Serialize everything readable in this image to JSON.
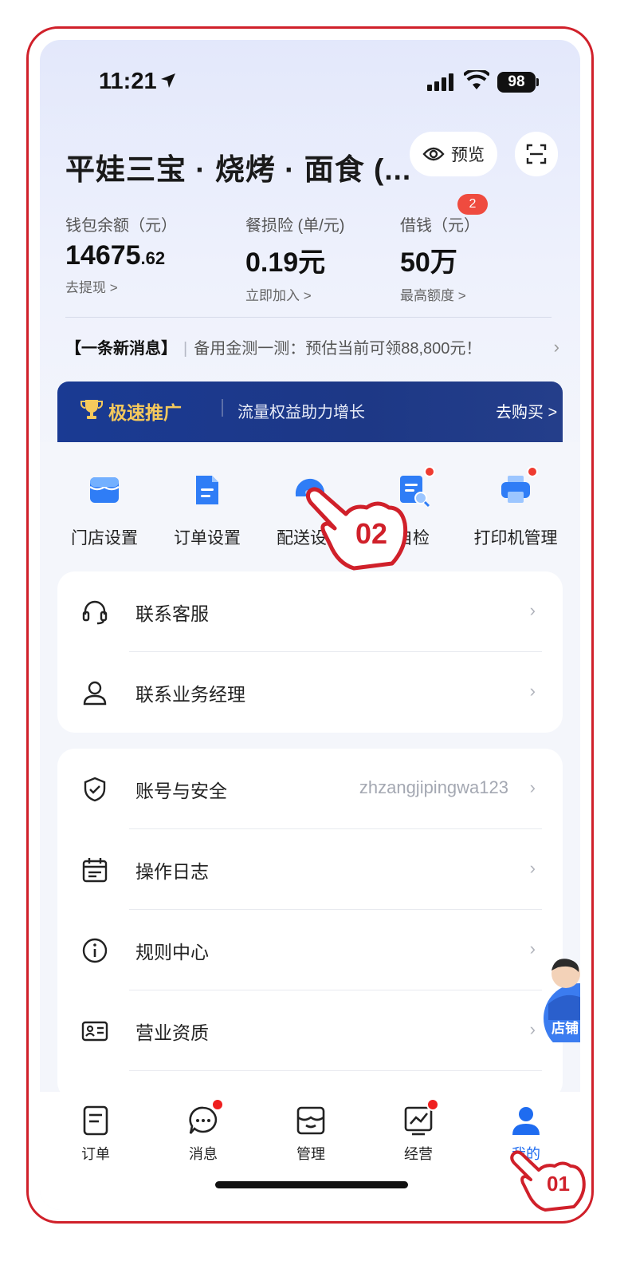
{
  "status_bar": {
    "time": "11:21",
    "battery": "98"
  },
  "header": {
    "shop_name": "平娃三宝 · 烧烤 · 面食 (...",
    "preview_label": "预览"
  },
  "stats": [
    {
      "label": "钱包余额（元）",
      "value_main": "14675",
      "value_decimal": ".62",
      "sub": "去提现 >"
    },
    {
      "label": "餐损险 (单/元)",
      "value_main": "0.19元",
      "value_decimal": "",
      "sub": "立即加入 >"
    },
    {
      "label": "借钱（元）",
      "value_main": "50万",
      "value_decimal": "",
      "sub": "最高额度 >",
      "badge": "2"
    }
  ],
  "news": {
    "tag": "【一条新消息】",
    "message": "备用金测一测：预估当前可领88,800元！"
  },
  "promo": {
    "title": "极速推广",
    "description": "流量权益助力增长",
    "action": "去购买 >"
  },
  "shortcuts": [
    {
      "label": "门店设置"
    },
    {
      "label": "订单设置"
    },
    {
      "label": "配送设置"
    },
    {
      "label": "自检"
    },
    {
      "label": "打印机管理"
    }
  ],
  "contact_card": [
    {
      "label": "联系客服"
    },
    {
      "label": "联系业务经理"
    }
  ],
  "settings_card": [
    {
      "label": "账号与安全",
      "value": "zhzangjipingwa123"
    },
    {
      "label": "操作日志"
    },
    {
      "label": "规则中心"
    },
    {
      "label": "营业资质"
    }
  ],
  "floating": {
    "label": "店铺"
  },
  "tabbar": [
    {
      "label": "订单"
    },
    {
      "label": "消息"
    },
    {
      "label": "管理"
    },
    {
      "label": "经营"
    },
    {
      "label": "我的"
    }
  ],
  "annotations": {
    "step1": "01",
    "step2": "02"
  },
  "colors": {
    "accent": "#1f6cf0",
    "annotation": "#d0202a",
    "badge": "#ef3b30"
  }
}
